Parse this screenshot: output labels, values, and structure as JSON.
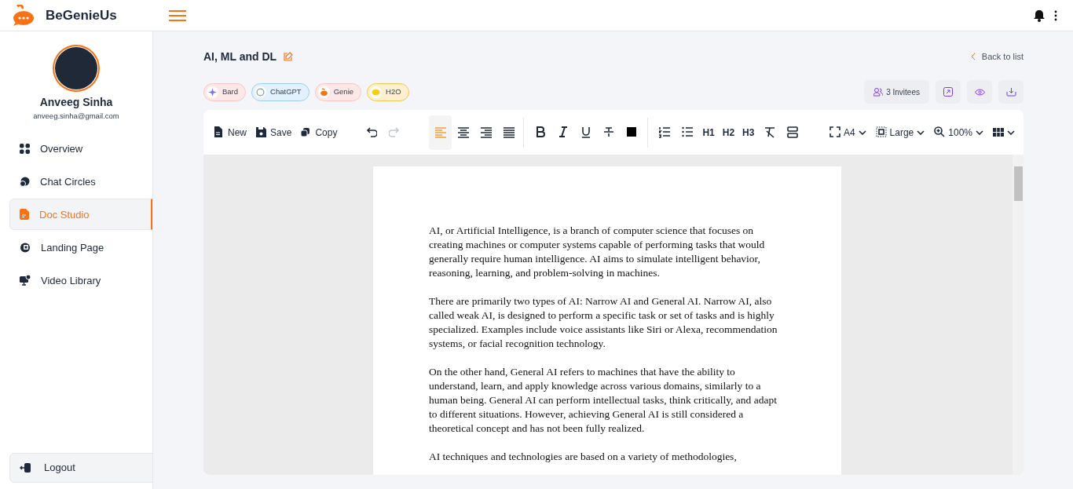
{
  "app": {
    "name": "BeGenieUs"
  },
  "user": {
    "name": "Anveeg Sinha",
    "email": "anveeg.sinha@gmail.com"
  },
  "nav": [
    {
      "label": "Overview",
      "selected": false
    },
    {
      "label": "Chat Circles",
      "selected": false
    },
    {
      "label": "Doc Studio",
      "selected": true
    },
    {
      "label": "Landing Page",
      "selected": false
    },
    {
      "label": "Video Library",
      "selected": false
    }
  ],
  "logout": "Logout",
  "document": {
    "title": "AI, ML and DL",
    "back_link": "Back to list"
  },
  "assistants": [
    {
      "label": "Bard",
      "color": "#fde8e8"
    },
    {
      "label": "ChatGPT",
      "color": "#e3f1fd"
    },
    {
      "label": "Genie",
      "color": "#fde8e8"
    },
    {
      "label": "H2O",
      "color": "#fdefcf"
    }
  ],
  "invitees": "3 Invitees",
  "toolbar": [
    {
      "items": [
        {
          "kind": "labeled",
          "label": "New"
        },
        {
          "kind": "labeled",
          "label": "Save"
        },
        {
          "kind": "labeled",
          "label": "Copy"
        }
      ]
    },
    {
      "items": [
        {
          "kind": "icon",
          "disabled": false
        },
        {
          "kind": "icon",
          "disabled": true
        }
      ]
    },
    {
      "items": [
        {
          "kind": "icon",
          "selected": true
        },
        {
          "kind": "icon",
          "selected": false
        },
        {
          "kind": "icon",
          "selected": false
        },
        {
          "kind": "icon",
          "selected": false
        }
      ]
    },
    {
      "items": [
        {
          "kind": "icon"
        },
        {
          "kind": "icon"
        },
        {
          "kind": "icon"
        },
        {
          "kind": "icon"
        },
        {
          "kind": "icon"
        }
      ]
    },
    {
      "items": [
        {
          "kind": "icon"
        },
        {
          "kind": "icon"
        },
        {
          "kind": "text",
          "label": "H1"
        },
        {
          "kind": "text",
          "label": "H2"
        },
        {
          "kind": "text",
          "label": "H3"
        },
        {
          "kind": "icon"
        },
        {
          "kind": "icon"
        }
      ]
    },
    {
      "items": [
        {
          "kind": "dropdown",
          "label": "A4"
        },
        {
          "kind": "dropdown",
          "label": "Large"
        },
        {
          "kind": "dropdown",
          "label": "100%"
        },
        {
          "kind": "dropdown"
        }
      ]
    }
  ],
  "paragraphs": [
    "AI, or Artificial Intelligence, is a branch of computer science that focuses on creating machines or computer systems capable of performing tasks that would generally require human intelligence. AI aims to simulate intelligent behavior, reasoning, learning, and problem-solving in machines.",
    "There are primarily two types of AI: Narrow AI and General AI. Narrow AI, also called weak AI, is designed to perform a specific task or set of tasks and is highly specialized. Examples include voice assistants like Siri or Alexa, recommendation systems, or facial recognition technology.",
    "On the other hand, General AI refers to machines that have the ability to understand, learn, and apply knowledge across various domains, similarly to a human being. General AI can perform intellectual tasks, think critically, and adapt to different situations. However, achieving General AI is still considered a theoretical concept and has not been fully realized.",
    "AI techniques and technologies are based on a variety of methodologies,"
  ]
}
